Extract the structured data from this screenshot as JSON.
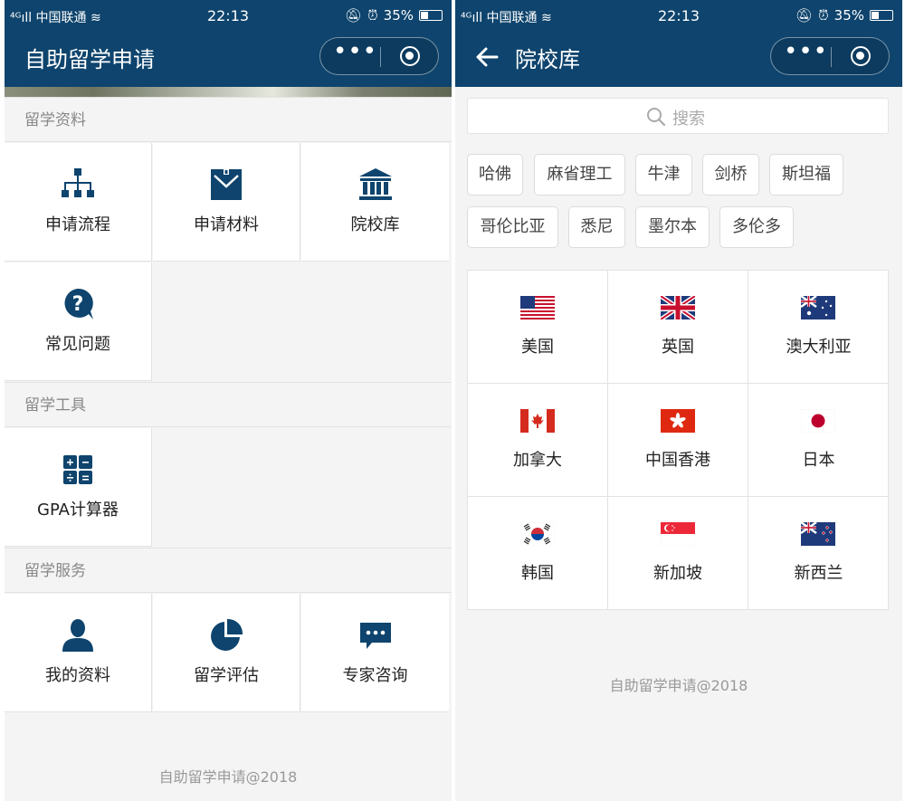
{
  "status": {
    "carrier": "⁴ᴳıll 中国联通 ≋",
    "time": "22:13",
    "battery": "35%"
  },
  "left": {
    "title": "自助留学申请",
    "sections": [
      {
        "title": "留学资料",
        "items": [
          {
            "label": "申请流程",
            "icon": "org-chart-icon"
          },
          {
            "label": "申请材料",
            "icon": "document-envelope-icon"
          },
          {
            "label": "院校库",
            "icon": "university-building-icon"
          },
          {
            "label": "常见问题",
            "icon": "question-bubble-icon"
          }
        ]
      },
      {
        "title": "留学工具",
        "items": [
          {
            "label": "GPA计算器",
            "icon": "calculator-icon"
          }
        ]
      },
      {
        "title": "留学服务",
        "items": [
          {
            "label": "我的资料",
            "icon": "user-icon"
          },
          {
            "label": "留学评估",
            "icon": "pie-chart-icon"
          },
          {
            "label": "专家咨询",
            "icon": "chat-bubble-icon"
          }
        ]
      }
    ],
    "footer": "自助留学申请@2018"
  },
  "right": {
    "title": "院校库",
    "search_placeholder": "搜索",
    "tags": [
      "哈佛",
      "麻省理工",
      "牛津",
      "剑桥",
      "斯坦福",
      "哥伦比亚",
      "悉尼",
      "墨尔本",
      "多伦多"
    ],
    "countries": [
      {
        "label": "美国",
        "icon": "us-flag-icon"
      },
      {
        "label": "英国",
        "icon": "uk-flag-icon"
      },
      {
        "label": "澳大利亚",
        "icon": "australia-flag-icon"
      },
      {
        "label": "加拿大",
        "icon": "canada-flag-icon"
      },
      {
        "label": "中国香港",
        "icon": "hongkong-flag-icon"
      },
      {
        "label": "日本",
        "icon": "japan-flag-icon"
      },
      {
        "label": "韩国",
        "icon": "korea-flag-icon"
      },
      {
        "label": "新加坡",
        "icon": "singapore-flag-icon"
      },
      {
        "label": "新西兰",
        "icon": "newzealand-flag-icon"
      }
    ],
    "footer": "自助留学申请@2018"
  },
  "colors": {
    "navbar": "#0e446d",
    "icon": "#0e446d",
    "background": "#f4f4f4"
  }
}
